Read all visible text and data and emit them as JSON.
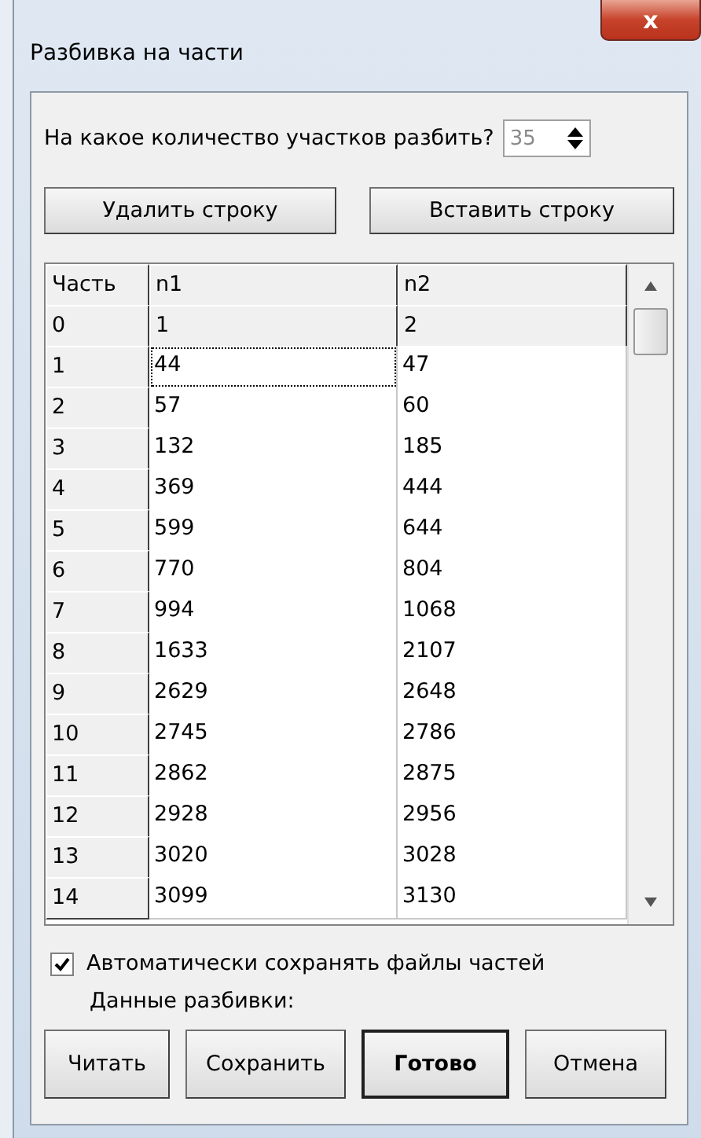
{
  "window": {
    "title": "Разбивка на части",
    "close": "x"
  },
  "count": {
    "label": "На какое количество участков разбить?",
    "value": "35"
  },
  "row_buttons": [
    "Удалить строку",
    "Вставить строку"
  ],
  "table": {
    "columns": [
      "Часть",
      "n1",
      "n2"
    ],
    "rows": [
      {
        "part": "0",
        "values": [
          "1",
          "2"
        ],
        "fixed": true,
        "focus": [
          false,
          false
        ]
      },
      {
        "part": "1",
        "values": [
          "44",
          "47"
        ],
        "fixed": false,
        "focus": [
          true,
          false
        ]
      },
      {
        "part": "2",
        "values": [
          "57",
          "60"
        ],
        "fixed": false,
        "focus": [
          false,
          false
        ]
      },
      {
        "part": "3",
        "values": [
          "132",
          "185"
        ],
        "fixed": false,
        "focus": [
          false,
          false
        ]
      },
      {
        "part": "4",
        "values": [
          "369",
          "444"
        ],
        "fixed": false,
        "focus": [
          false,
          false
        ]
      },
      {
        "part": "5",
        "values": [
          "599",
          "644"
        ],
        "fixed": false,
        "focus": [
          false,
          false
        ]
      },
      {
        "part": "6",
        "values": [
          "770",
          "804"
        ],
        "fixed": false,
        "focus": [
          false,
          false
        ]
      },
      {
        "part": "7",
        "values": [
          "994",
          "1068"
        ],
        "fixed": false,
        "focus": [
          false,
          false
        ]
      },
      {
        "part": "8",
        "values": [
          "1633",
          "2107"
        ],
        "fixed": false,
        "focus": [
          false,
          false
        ]
      },
      {
        "part": "9",
        "values": [
          "2629",
          "2648"
        ],
        "fixed": false,
        "focus": [
          false,
          false
        ]
      },
      {
        "part": "10",
        "values": [
          "2745",
          "2786"
        ],
        "fixed": false,
        "focus": [
          false,
          false
        ]
      },
      {
        "part": "11",
        "values": [
          "2862",
          "2875"
        ],
        "fixed": false,
        "focus": [
          false,
          false
        ]
      },
      {
        "part": "12",
        "values": [
          "2928",
          "2956"
        ],
        "fixed": false,
        "focus": [
          false,
          false
        ]
      },
      {
        "part": "13",
        "values": [
          "3020",
          "3028"
        ],
        "fixed": false,
        "focus": [
          false,
          false
        ]
      },
      {
        "part": "14",
        "values": [
          "3099",
          "3130"
        ],
        "fixed": false,
        "focus": [
          false,
          false
        ]
      }
    ]
  },
  "autosave": {
    "label": "Автоматически сохранять файлы частей",
    "checked": true
  },
  "data_label": "Данные разбивки:",
  "buttons": [
    {
      "label": "Читать",
      "default": false
    },
    {
      "label": "Сохранить",
      "default": false
    },
    {
      "label": "Готово",
      "default": true
    },
    {
      "label": "Отмена",
      "default": false
    }
  ]
}
